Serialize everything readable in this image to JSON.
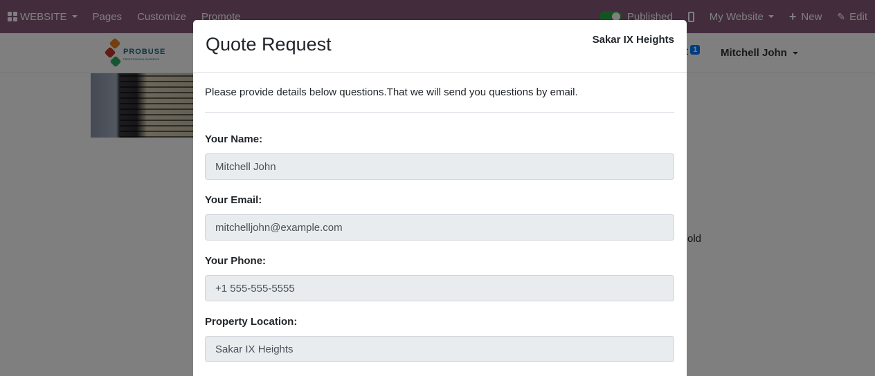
{
  "topbar": {
    "website_label": "WEBSITE",
    "pages_label": "Pages",
    "customize_label": "Customize",
    "promote_label": "Promote",
    "published_label": "Published",
    "my_website_label": "My Website",
    "new_label": "New",
    "edit_label": "Edit",
    "bg_color": "#875a7b",
    "toggle_color": "#28a745"
  },
  "header": {
    "logo_text": "PROBUSE",
    "logo_tagline": "PROFESSIONAL BUSINESS",
    "cart_label": "rt",
    "cart_count": "1",
    "user_name": "Mitchell John"
  },
  "page": {
    "sold_fragment": "old"
  },
  "modal": {
    "title": "Quote Request",
    "property_name": "Sakar IX Heights",
    "intro": "Please provide details below questions.That we will send you questions by email.",
    "fields": [
      {
        "label": "Your Name:",
        "value": "Mitchell John"
      },
      {
        "label": "Your Email:",
        "value": "mitchelljohn@example.com"
      },
      {
        "label": "Your Phone:",
        "value": "+1 555-555-5555"
      },
      {
        "label": "Property Location:",
        "value": "Sakar IX Heights"
      }
    ]
  }
}
